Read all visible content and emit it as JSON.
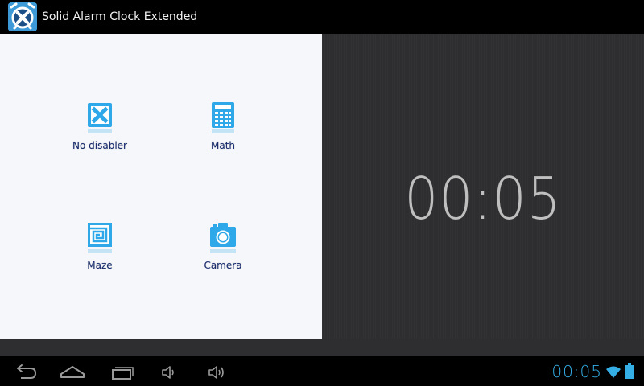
{
  "app": {
    "title": "Solid Alarm Clock Extended",
    "icon": "app-alarm-icon"
  },
  "disablers": [
    {
      "label": "No disabler",
      "icon": "no-disabler-icon"
    },
    {
      "label": "Math",
      "icon": "calculator-icon"
    },
    {
      "label": "Maze",
      "icon": "maze-icon"
    },
    {
      "label": "Camera",
      "icon": "camera-icon"
    }
  ],
  "clock": {
    "time": "00:05"
  },
  "system_bar": {
    "time": "00:05",
    "nav": [
      "back-icon",
      "home-icon",
      "recent-apps-icon",
      "volume-down-icon",
      "volume-up-icon"
    ],
    "status_icons": [
      "wifi-icon",
      "battery-icon"
    ]
  },
  "colors": {
    "accent": "#35aee6",
    "panel_light": "#f6f7fa",
    "panel_dark": "#2e2e31",
    "clock_text": "#bfbfbf",
    "label_text": "#1a2a6a"
  }
}
